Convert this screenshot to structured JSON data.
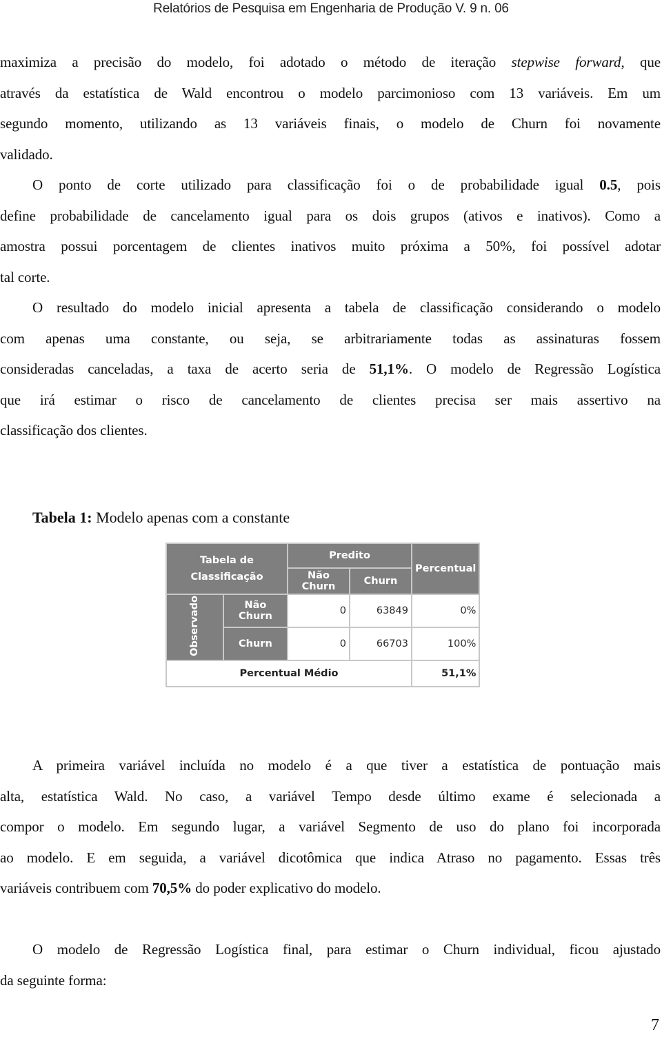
{
  "header": {
    "running_title": "Relatórios de Pesquisa em Engenharia de Produção V. 9 n. 06"
  },
  "paragraph_1": {
    "lines": [
      [
        "maximiza a precisão do modelo, foi adotado o método de iteração ",
        "stepwise forward",
        ", que"
      ],
      "através da estatística de Wald encontrou o modelo parcimonioso com 13 variáveis. Em um",
      "segundo momento, utilizando as 13 variáveis finais, o modelo de Churn foi novamente",
      "validado."
    ],
    "line1_pre": "maximiza a precisão do modelo, foi adotado o método de iteração ",
    "line1_italic": "stepwise forward",
    "line1_post": ", que",
    "line2": "através da estatística de Wald encontrou o modelo parcimonioso com 13 variáveis. Em um",
    "line3": "segundo momento, utilizando as 13 variáveis finais, o modelo de Churn foi novamente",
    "line4": "validado."
  },
  "paragraph_2": {
    "line1_pre": "O ponto de corte utilizado para classificação foi o de probabilidade igual ",
    "line1_bold": "0.5",
    "line1_post": ", pois",
    "line2": "define probabilidade de cancelamento igual para os dois grupos (ativos e inativos). Como a",
    "line3": "amostra possui porcentagem de clientes inativos muito próxima a 50%, foi possível adotar",
    "line4": "tal corte."
  },
  "paragraph_3": {
    "line1": "O resultado do modelo inicial apresenta a tabela de classificação considerando o modelo",
    "line2": "com apenas uma constante, ou seja, se arbitrariamente todas as assinaturas fossem",
    "line3_pre": "consideradas canceladas, a taxa de acerto seria de ",
    "line3_bold": "51,1%",
    "line3_post": ". O modelo de Regressão Logística",
    "line4": "que irá estimar o risco de cancelamento de clientes precisa ser mais assertivo na",
    "line5": "classificação dos clientes."
  },
  "table_caption": {
    "label": "Tabela 1:",
    "text": " Modelo apenas com a constante"
  },
  "classification_table": {
    "corner_label": "Tabela de Classificação",
    "predicted_label": "Predito",
    "percent_label": "Percentual",
    "observed_label": "Observado",
    "columns": [
      "Não Churn",
      "Churn"
    ],
    "rows": [
      {
        "label": "Não Churn",
        "values": [
          "0",
          "63849"
        ],
        "percent": "0%"
      },
      {
        "label": "Churn",
        "values": [
          "0",
          "66703"
        ],
        "percent": "100%"
      }
    ],
    "footer_label": "Percentual Médio",
    "footer_value": "51,1%"
  },
  "paragraph_4": {
    "line1": "A primeira variável incluída no modelo é a que tiver a estatística de pontuação mais",
    "line2": "alta, estatística Wald. No caso, a variável Tempo desde último exame é selecionada a",
    "line3": "compor o modelo. Em segundo lugar, a variável Segmento de uso do plano foi incorporada",
    "line4": "ao modelo. E em seguida, a variável dicotômica que indica Atraso no pagamento. Essas três",
    "line5_pre": "variáveis contribuem com ",
    "line5_bold": "70,5%",
    "line5_post": " do poder explicativo do modelo."
  },
  "paragraph_5": {
    "line1": "O modelo de Regressão Logística final, para estimar o Churn individual, ficou ajustado",
    "line2": "da seguinte forma:"
  },
  "footer": {
    "page_number": "7"
  }
}
